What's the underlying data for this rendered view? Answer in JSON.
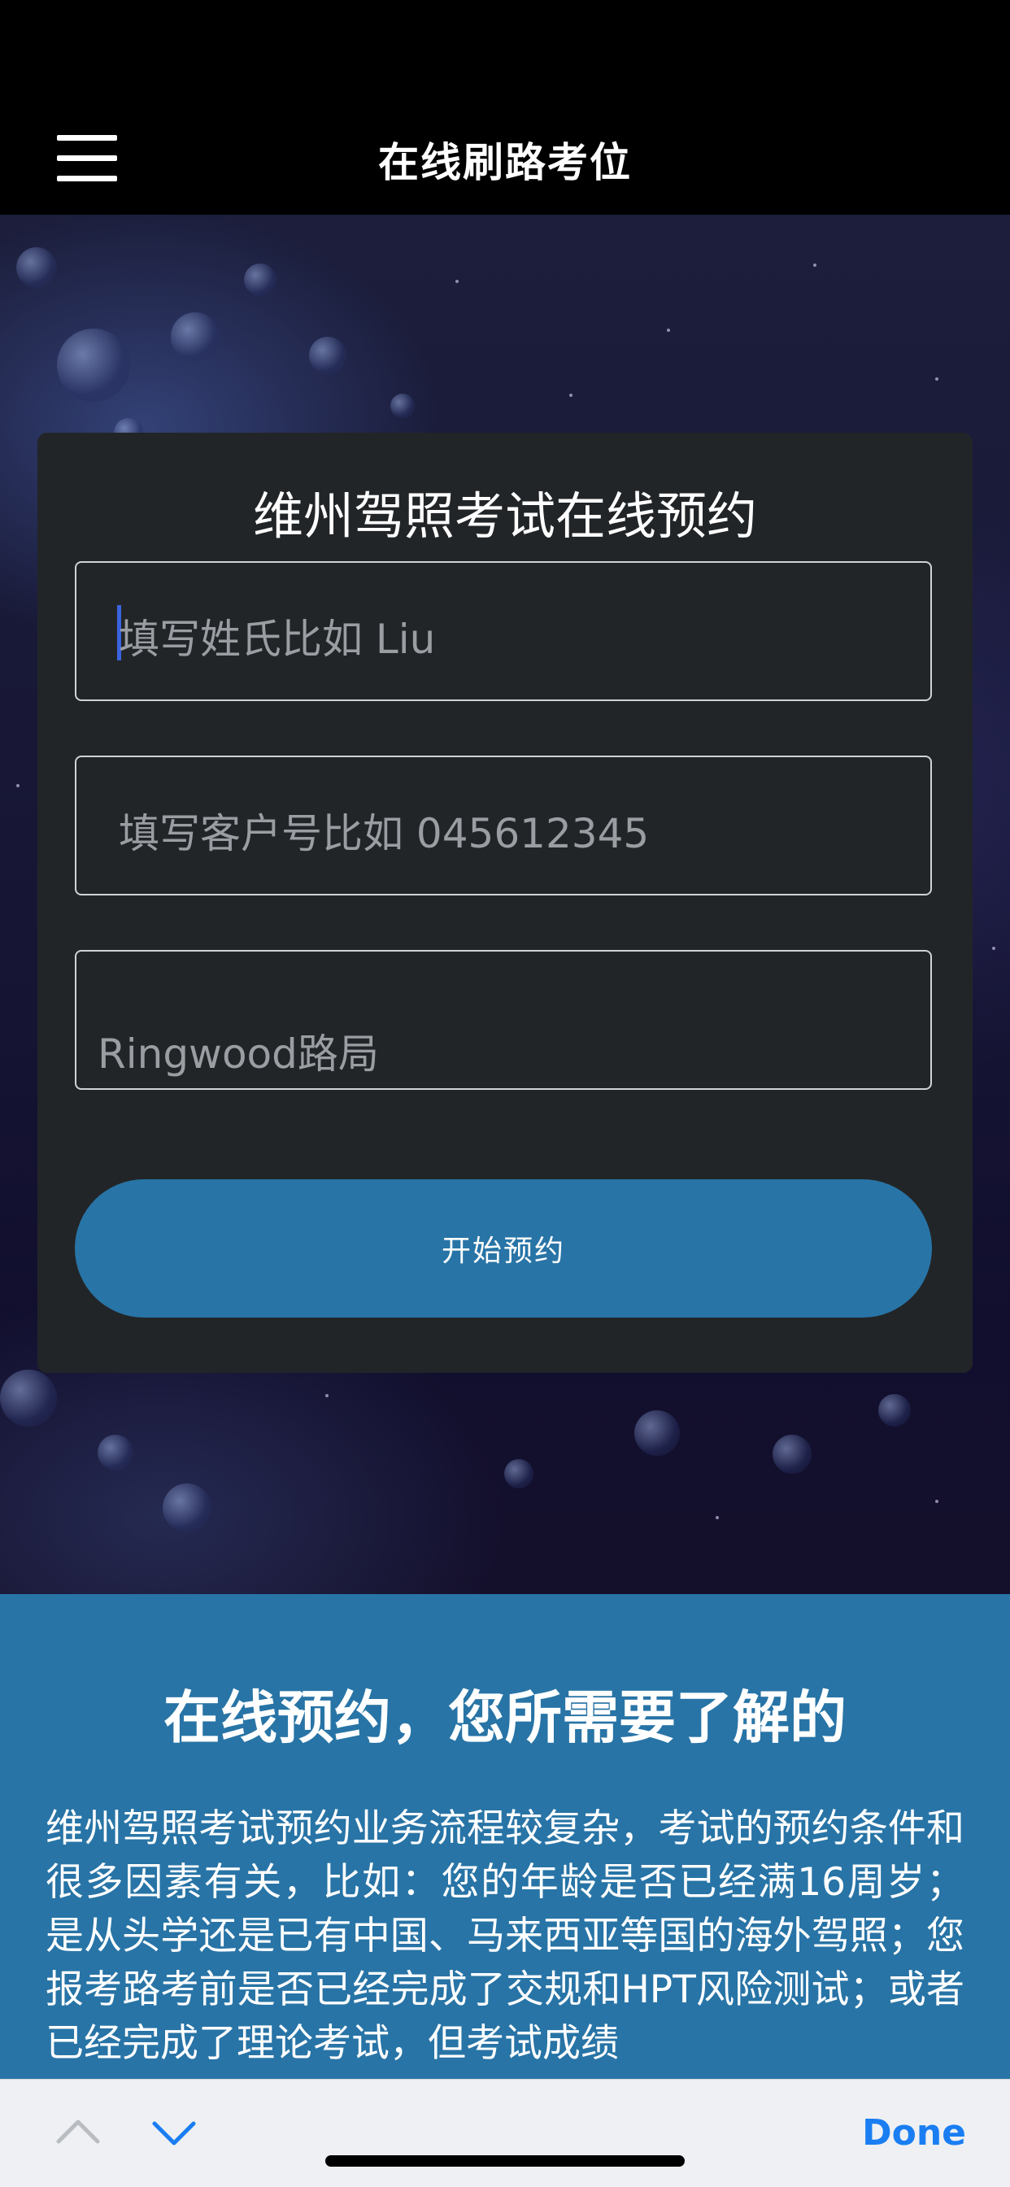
{
  "header": {
    "title": "在线刷路考位",
    "menu_icon": "hamburger-menu-icon"
  },
  "form": {
    "title": "维州驾照考试在线预约",
    "surname_placeholder": "填写姓氏比如 Liu",
    "customer_no_placeholder": "填写客户号比如 045612345",
    "location_value": "Ringwood路局",
    "submit_label": "开始预约"
  },
  "info": {
    "heading": "在线预约，您所需要了解的",
    "body": "维州驾照考试预约业务流程较复杂，考试的预约条件和很多因素有关，比如：您的年龄是否已经满16周岁；是从头学还是已有中国、马来西亚等国的海外驾照；您报考路考前是否已经完成了交规和HPT风险测试；或者已经完成了理论考试，但考试成绩"
  },
  "keyboard_toolbar": {
    "prev_icon": "chevron-up-icon",
    "next_icon": "chevron-down-icon",
    "done_label": "Done"
  },
  "colors": {
    "accent": "#2874a6",
    "card": "#222528",
    "done": "#1a7ef2"
  }
}
